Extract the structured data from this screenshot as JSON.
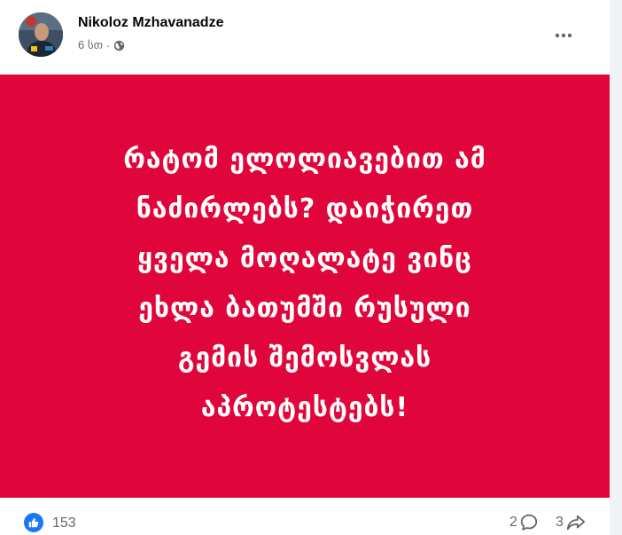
{
  "post": {
    "author": "Nikoloz Mzhavanadze",
    "time": "6 სთ",
    "separator": "·",
    "privacy_icon": "globe-icon",
    "background_color": "#e0063b",
    "text_lines": [
      "რატომ ელოლიავებით ამ",
      "ნაძირლებს? დაიჭირეთ",
      "ყველა მოღალატე ვინც",
      "ეხლა ბათუმში რუსული",
      "გემის შემოსვლას",
      "აპროტესტებს!"
    ]
  },
  "footer": {
    "reaction_icon": "like-icon",
    "reaction_count": "153",
    "comment_count": "2",
    "comment_icon": "comment-icon",
    "share_count": "3",
    "share_icon": "share-icon"
  },
  "colors": {
    "accent": "#1877f2",
    "secondary_text": "#65676b",
    "primary_text": "#050505"
  }
}
